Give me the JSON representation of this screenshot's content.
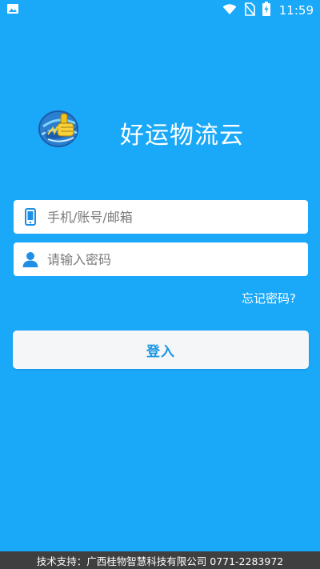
{
  "status_bar": {
    "time": "11:59",
    "icons": [
      "image-icon",
      "wifi-icon",
      "no-sim-icon",
      "battery-charging-icon"
    ]
  },
  "app": {
    "title": "好运物流云",
    "logo_icon": "thumbs-up-globe-logo"
  },
  "login_form": {
    "account_placeholder": "手机/账号/邮箱",
    "account_icon": "phone-icon",
    "password_placeholder": "请输入密码",
    "password_icon": "user-icon",
    "forgot_label": "忘记密码?",
    "submit_label": "登入"
  },
  "footer": {
    "text": "技术支持：广西桂物智慧科技有限公司 0771-2283972"
  },
  "colors": {
    "background": "#1aa8f9",
    "button_text": "#1a96e4",
    "footer_bg": "#3f3f3f"
  }
}
